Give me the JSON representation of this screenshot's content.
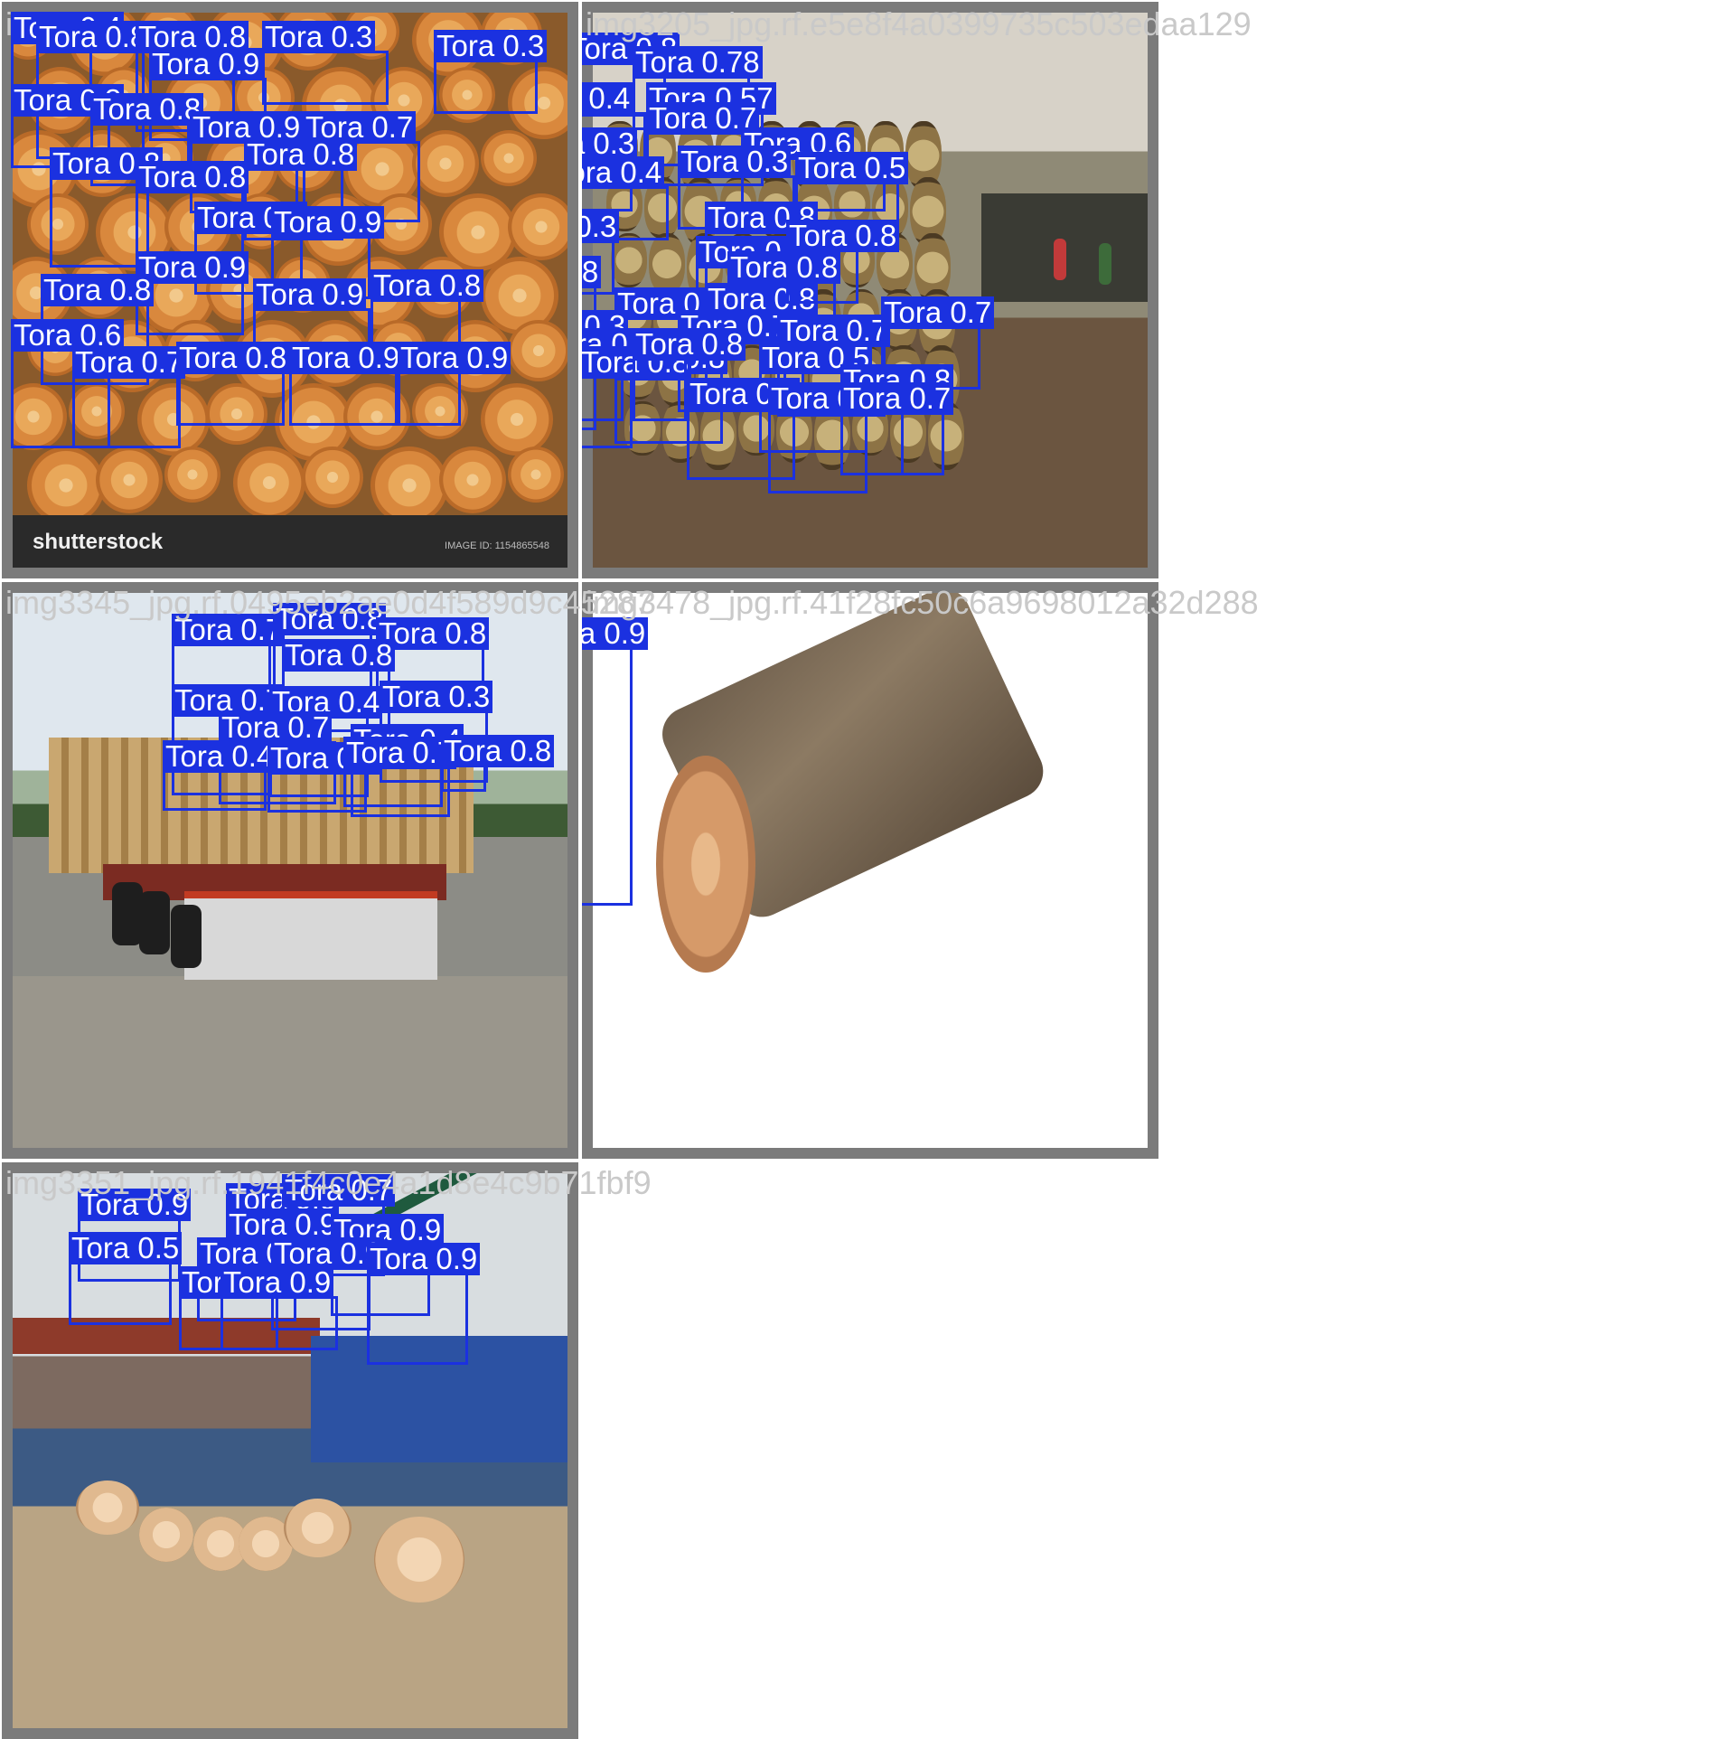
{
  "captions": [
    "img3205_jpg.rf.e5e8f4a0399735c503edaa129",
    "img3345_jpg.rf.0495eb2ae0d4f589d9c45287",
    "img3478_jpg.rf.41f28fc50c6a9698012a32d288",
    "img3351_jpg.rf.1941f4c0e4a1d8e4c9b71fbf9"
  ],
  "tile0_caption": "i",
  "tile0_watermark": "shutterstock",
  "tile0_image_id": "IMAGE ID: 1154865548",
  "box_color": "#1b31e0",
  "class_name": "Tora",
  "detections": {
    "tile0": [
      {
        "label": "Tora 0.4"
      },
      {
        "label": "Tora 0.8"
      },
      {
        "label": "Tora 0.8"
      },
      {
        "label": "Tora 0.3"
      },
      {
        "label": "Tora 0.9"
      },
      {
        "label": "Tora 0.3"
      },
      {
        "label": "Tora 0.8"
      },
      {
        "label": "Tora 0.8"
      },
      {
        "label": "Tora 0.9"
      },
      {
        "label": "Tora 0.7"
      },
      {
        "label": "Tora 0.8"
      },
      {
        "label": "Tora 0.8"
      },
      {
        "label": "Tora 0.8"
      },
      {
        "label": "Tora 0.9"
      },
      {
        "label": "Tora 0.9"
      },
      {
        "label": "Tora 0.9"
      },
      {
        "label": "Tora 0.8"
      },
      {
        "label": "Tora 0.9"
      },
      {
        "label": "Tora 0.8"
      },
      {
        "label": "Tora 0.6"
      },
      {
        "label": "Tora 0.7"
      },
      {
        "label": "Tora 0.8"
      },
      {
        "label": "Tora 0.9"
      },
      {
        "label": "Tora 0.9"
      }
    ],
    "tile1": [
      {
        "label": "Tora 0.8"
      },
      {
        "label": "Tora 0.78"
      },
      {
        "label": "Tora 0.3"
      },
      {
        "label": "Tora 0.4"
      },
      {
        "label": "Tora 0.57"
      },
      {
        "label": "Tora 0.7"
      },
      {
        "label": "Tora 0.3"
      },
      {
        "label": "Tora 0.4"
      },
      {
        "label": "Tora 0.6"
      },
      {
        "label": "Tora 0.3"
      },
      {
        "label": "Tora 0.5"
      },
      {
        "label": "Tora 0.3"
      },
      {
        "label": "Tora 0.8"
      },
      {
        "label": "Tora 0.3"
      },
      {
        "label": "Tora 0.8"
      },
      {
        "label": "Tora 0.8"
      },
      {
        "label": "Tora 0.3"
      },
      {
        "label": "Tora 0.8"
      },
      {
        "label": "Tora 0.3"
      },
      {
        "label": "Tora 0.7"
      },
      {
        "label": "Tora 0.7"
      },
      {
        "label": "Tora 0.7"
      },
      {
        "label": "Tora 0.8"
      },
      {
        "label": "Tora 0.5"
      },
      {
        "label": "Tora 0.8"
      },
      {
        "label": "Tora 0.4"
      },
      {
        "label": "Tora 0.5"
      },
      {
        "label": "Tora 0.7"
      },
      {
        "label": "Tora 0.8"
      },
      {
        "label": "Tora 0.8"
      },
      {
        "label": "Tora 0.8"
      },
      {
        "label": "Tora 0.8"
      }
    ],
    "tile2": [
      {
        "label": "Tora 0.7"
      },
      {
        "label": "Tora 0.8"
      },
      {
        "label": "Tora 0.8"
      },
      {
        "label": "Tora 0.8"
      },
      {
        "label": "Tora 0.7"
      },
      {
        "label": "Tora 0.4"
      },
      {
        "label": "Tora 0.3"
      },
      {
        "label": "Tora 0.7"
      },
      {
        "label": "Tora 0.4"
      },
      {
        "label": "Tora 0.4"
      },
      {
        "label": "Tora 0.7"
      },
      {
        "label": "Tora 0.7"
      },
      {
        "label": "Tora 0.8"
      }
    ],
    "tile3": [
      {
        "label": "Tora 0.9"
      }
    ],
    "tile4": [
      {
        "label": "Tora 0.9"
      },
      {
        "label": "Tora 0.9"
      },
      {
        "label": "Tora 0.7"
      },
      {
        "label": "Tora 0.9"
      },
      {
        "label": "Tora 0.9"
      },
      {
        "label": "Tora 0.5"
      },
      {
        "label": "Tora 0.8"
      },
      {
        "label": "Tora 0.9"
      },
      {
        "label": "Tora 0.9"
      },
      {
        "label": "Tora 0.8"
      },
      {
        "label": "Tora 0.9"
      }
    ]
  }
}
